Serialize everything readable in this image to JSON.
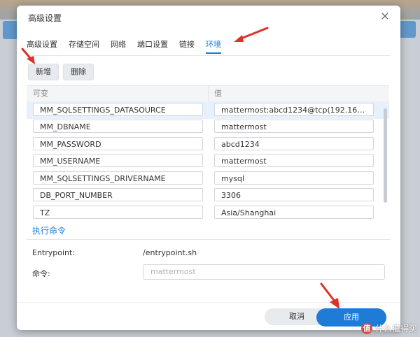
{
  "dialog": {
    "title": "高级设置",
    "close_glyph": "×",
    "tabs": [
      {
        "label": "高级设置",
        "active": false
      },
      {
        "label": "存储空间",
        "active": false
      },
      {
        "label": "网络",
        "active": false
      },
      {
        "label": "端口设置",
        "active": false
      },
      {
        "label": "链接",
        "active": false
      },
      {
        "label": "环境",
        "active": true
      }
    ],
    "toolbar": {
      "add_label": "新增",
      "delete_label": "删除"
    },
    "table": {
      "headers": [
        "可变",
        "值"
      ],
      "rows": [
        {
          "name": "MM_SQLSETTINGS_DATASOURCE",
          "value": "mattermost:abcd1234@tcp(192.16…",
          "selected": true
        },
        {
          "name": "MM_DBNAME",
          "value": "mattermost",
          "selected": false
        },
        {
          "name": "MM_PASSWORD",
          "value": "abcd1234",
          "selected": false
        },
        {
          "name": "MM_USERNAME",
          "value": "mattermost",
          "selected": false
        },
        {
          "name": "MM_SQLSETTINGS_DRIVERNAME",
          "value": "mysql",
          "selected": false
        },
        {
          "name": "DB_PORT_NUMBER",
          "value": "3306",
          "selected": false
        },
        {
          "name": "TZ",
          "value": "Asia/Shanghai",
          "selected": false
        }
      ]
    },
    "exec": {
      "section_title": "执行命令",
      "entrypoint_label": "Entrypoint:",
      "entrypoint_value": "/entrypoint.sh",
      "command_label": "命令:",
      "command_placeholder": "mattermost"
    },
    "footer": {
      "cancel_label": "取消",
      "apply_label": "应用"
    }
  },
  "watermark": {
    "icon_text": "值",
    "text": "什么值得买"
  },
  "colors": {
    "accent": "#1f7bd8",
    "arrow": "#e0302a"
  }
}
